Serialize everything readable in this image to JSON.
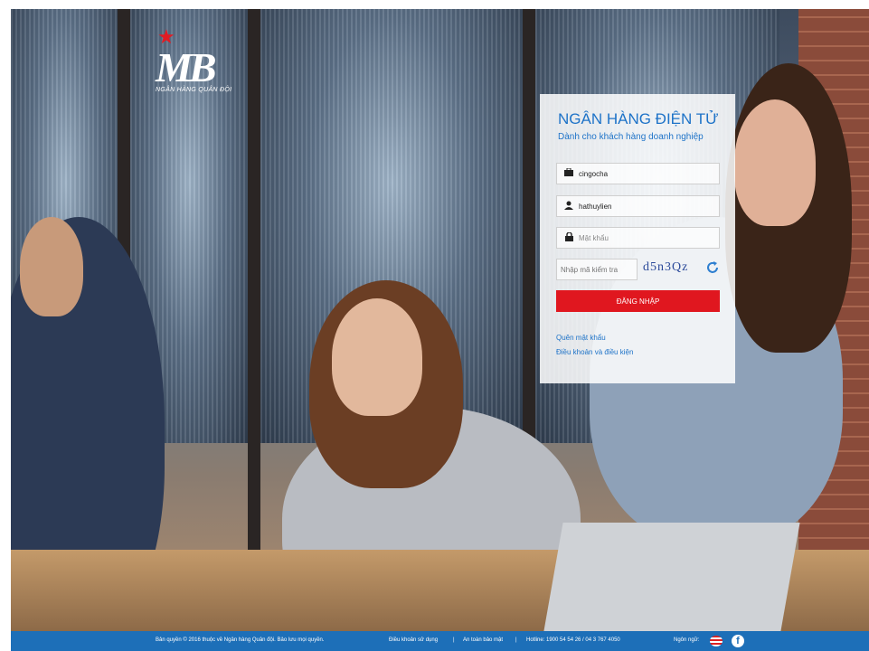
{
  "brand": {
    "logo_text": "MB",
    "logo_sub": "NGÂN HÀNG QUÂN ĐỘI",
    "accent": "#e0171f",
    "primary": "#1e73c8"
  },
  "login": {
    "title": "NGÂN HÀNG ĐIỆN TỬ",
    "subtitle": "Dành cho khách hàng doanh nghiệp",
    "company_value": "cingocha",
    "username_value": "hathuylien",
    "password_placeholder": "Mật khẩu",
    "captcha_placeholder": "Nhập mã kiểm tra",
    "captcha_text": "d5n3Qz",
    "login_button": "ĐĂNG NHẬP",
    "forgot_password": "Quên mật khẩu",
    "terms": "Điều khoản và điều kiện"
  },
  "footer": {
    "copyright": "Bản quyền © 2016 thuộc về Ngân hàng Quân đội. Bảo lưu mọi quyền.",
    "terms_link": "Điều khoản sử dụng",
    "separator": "|",
    "security_link": "An toàn bảo mật",
    "hotline": "Hotline: 1900 54 54 26 / 04 3 767 4050",
    "language_label": "Ngôn ngữ:",
    "facebook_glyph": "f"
  }
}
